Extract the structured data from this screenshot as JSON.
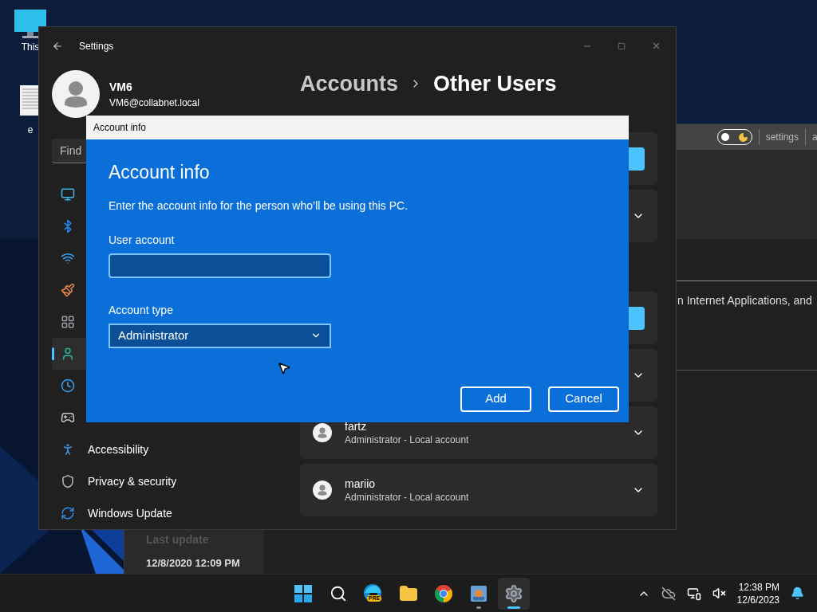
{
  "desktop_icons": [
    {
      "label": "This"
    },
    {
      "label": "e"
    }
  ],
  "background_window": {
    "dark_mode": true,
    "toolbar_links": [
      "settings",
      "a"
    ],
    "body_text": "n Internet Applications, and",
    "last_update": {
      "label": "Last update",
      "value": "12/8/2020 12:09 PM"
    }
  },
  "settings": {
    "title": "Settings",
    "user": {
      "name": "VM6",
      "email": "VM6@collabnet.local"
    },
    "breadcrumb": [
      "Accounts",
      "Other Users"
    ],
    "search": {
      "placeholder": "Find"
    },
    "nav": [
      {
        "selected": false
      },
      {
        "selected": false
      },
      {
        "selected": false
      },
      {
        "selected": false
      },
      {
        "selected": false
      },
      {
        "selected": true
      },
      {
        "selected": false
      },
      {
        "selected": false
      },
      {
        "label": "Accessibility",
        "selected": false
      },
      {
        "label": "Privacy & security",
        "selected": false
      },
      {
        "label": "Windows Update",
        "selected": false
      }
    ],
    "cards": [
      {
        "kind": "action"
      },
      {
        "kind": "expander"
      },
      {
        "kind": "action"
      },
      {
        "kind": "expander"
      },
      {
        "kind": "user",
        "name": "fartz",
        "detail": "Administrator - Local account"
      },
      {
        "kind": "user",
        "name": "mariio",
        "detail": "Administrator - Local account"
      }
    ]
  },
  "dialog": {
    "title": "Account info",
    "heading": "Account info",
    "description": "Enter the account info for the person who’ll be using this PC.",
    "user_account": {
      "label": "User account"
    },
    "account_type": {
      "label": "Account type",
      "value": "Administrator"
    },
    "buttons": [
      "Add",
      "Cancel"
    ]
  },
  "taskbar": {
    "apps": [
      {
        "selected": false,
        "running": false
      },
      {
        "selected": false,
        "running": false
      },
      {
        "selected": false,
        "running": false,
        "badge": "PRE"
      },
      {
        "selected": false,
        "running": false
      },
      {
        "selected": false,
        "running": false
      },
      {
        "selected": false,
        "running": true
      },
      {
        "selected": true,
        "running": true
      }
    ],
    "clock": {
      "time": "12:38 PM",
      "date": "12/6/2023"
    }
  }
}
